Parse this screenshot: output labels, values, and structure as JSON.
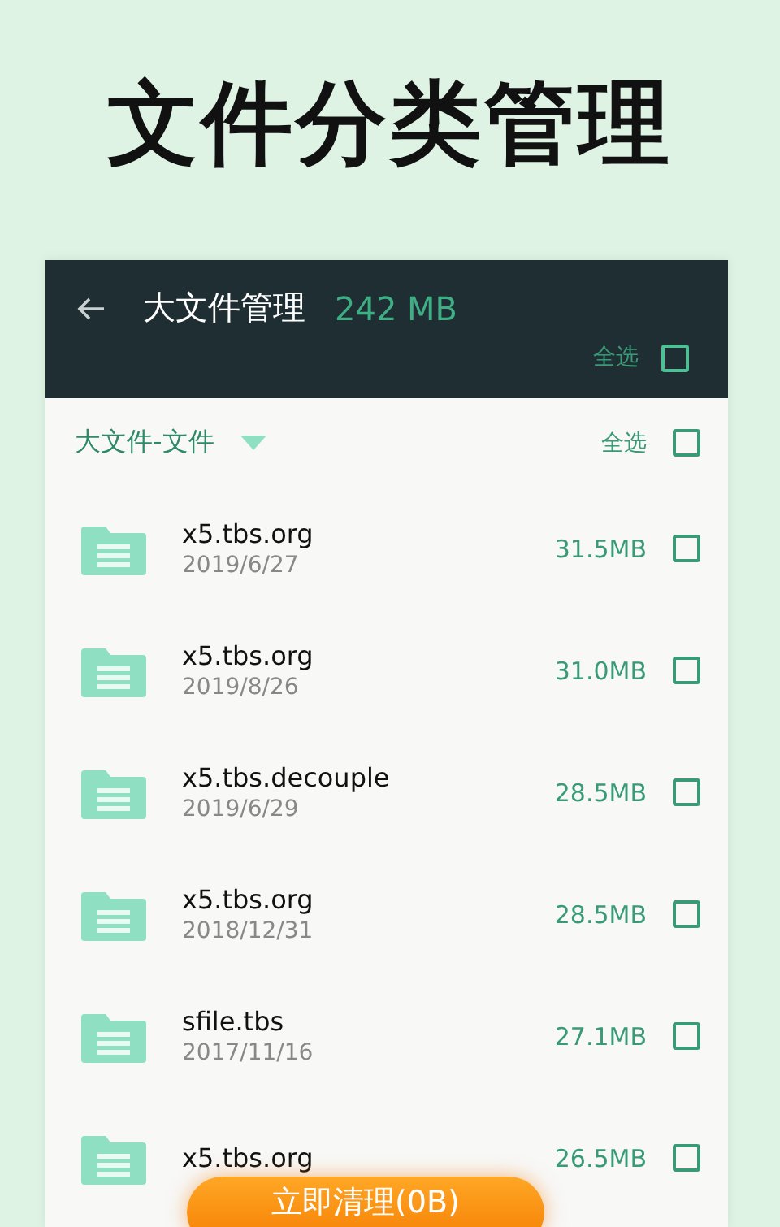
{
  "headline": "文件分类管理",
  "header": {
    "title": "大文件管理",
    "total": "242 MB",
    "select_all": {
      "label": "全选",
      "checked": false
    }
  },
  "group": {
    "title": "大文件-文件",
    "expanded": true,
    "select_all": {
      "label": "全选",
      "checked": false
    }
  },
  "files": [
    {
      "name": "x5.tbs.org",
      "date": "2019/6/27",
      "size": "31.5MB",
      "checked": false
    },
    {
      "name": "x5.tbs.org",
      "date": "2019/8/26",
      "size": "31.0MB",
      "checked": false
    },
    {
      "name": "x5.tbs.decouple",
      "date": "2019/6/29",
      "size": "28.5MB",
      "checked": false
    },
    {
      "name": "x5.tbs.org",
      "date": "2018/12/31",
      "size": "28.5MB",
      "checked": false
    },
    {
      "name": "sfile.tbs",
      "date": "2017/11/16",
      "size": "27.1MB",
      "checked": false
    },
    {
      "name": "x5.tbs.org",
      "size": "26.5MB",
      "checked": false
    }
  ],
  "clean_button": "立即清理(0B)"
}
